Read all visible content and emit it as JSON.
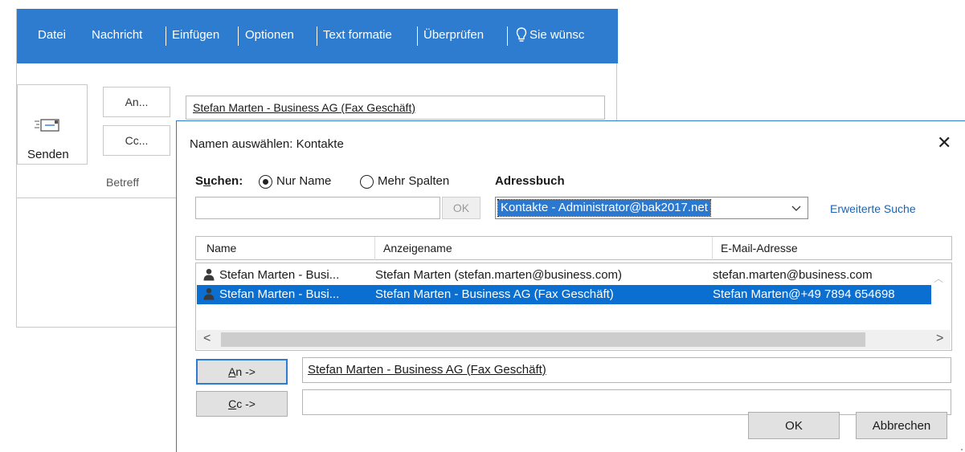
{
  "ribbon": {
    "tabs": [
      "Datei",
      "Nachricht",
      "Einfügen",
      "Optionen",
      "Text formatie",
      "Überprüfen",
      "Sie wünsc"
    ],
    "color": "#2d7ccf"
  },
  "compose": {
    "send_label": "Senden",
    "to_button": "An...",
    "cc_button": "Cc...",
    "subject_label": "Betreff",
    "to_value": "Stefan Marten - Business AG (Fax Geschäft)"
  },
  "dialog": {
    "title": "Namen auswählen: Kontakte",
    "close": "✕",
    "search_label": "Suchen:",
    "radio_name_only": "Nur Name",
    "radio_more_columns": "Mehr Spalten",
    "addressbook_label": "Adressbuch",
    "search_value": "",
    "ok_small": "OK",
    "addressbook_selected": "Kontakte - Administrator@bak2017.net",
    "advanced_search": "Erweiterte Suche",
    "columns": [
      "Name",
      "Anzeigename",
      "E-Mail-Adresse"
    ],
    "rows": [
      {
        "name": "Stefan Marten - Busi...",
        "display": "Stefan Marten (stefan.marten@business.com)",
        "email": "stefan.marten@business.com",
        "selected": false
      },
      {
        "name": "Stefan Marten - Busi...",
        "display": "Stefan Marten - Business AG (Fax Geschäft)",
        "email": "Stefan Marten@+49 7894 654698",
        "selected": true
      }
    ],
    "to_button": "An ->",
    "cc_button": "Cc ->",
    "to_field": "Stefan Marten - Business AG (Fax Geschäft)",
    "cc_field": "",
    "ok": "OK",
    "cancel": "Abbrechen",
    "selection_color": "#0b6fd2"
  }
}
